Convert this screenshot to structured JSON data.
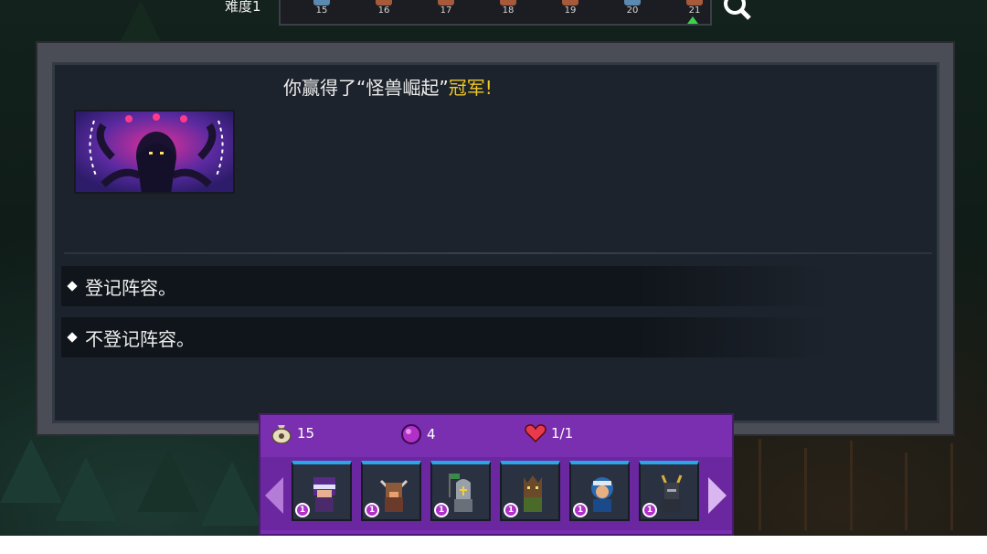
{
  "stage": {
    "difficulty_label": "难度1",
    "nodes": [
      {
        "num": "15",
        "style": "blue"
      },
      {
        "num": "16",
        "style": "red"
      },
      {
        "num": "17",
        "style": "red"
      },
      {
        "num": "18",
        "style": "red"
      },
      {
        "num": "19",
        "style": "red"
      },
      {
        "num": "20",
        "style": "blue"
      },
      {
        "num": "21",
        "style": "red",
        "current": true
      }
    ]
  },
  "dialog": {
    "title_prefix": "你赢得了“怪兽崛起”",
    "title_highlight": "冠军!",
    "options": [
      {
        "label": "登记阵容。"
      },
      {
        "label": "不登记阵容。"
      }
    ]
  },
  "party": {
    "gold": "15",
    "gems": "4",
    "lives": "1/1",
    "units": [
      {
        "name": "ninja",
        "level": "1"
      },
      {
        "name": "minotaur",
        "level": "1"
      },
      {
        "name": "knight",
        "level": "1"
      },
      {
        "name": "treant",
        "level": "1"
      },
      {
        "name": "monkey-ninja",
        "level": "1"
      },
      {
        "name": "dark-knight",
        "level": "1"
      }
    ]
  },
  "colors": {
    "highlight": "#f0c828",
    "panel_purple": "#7a2fb0",
    "dialog_bg": "#1d232c",
    "accent_blue": "#29a6e8"
  }
}
